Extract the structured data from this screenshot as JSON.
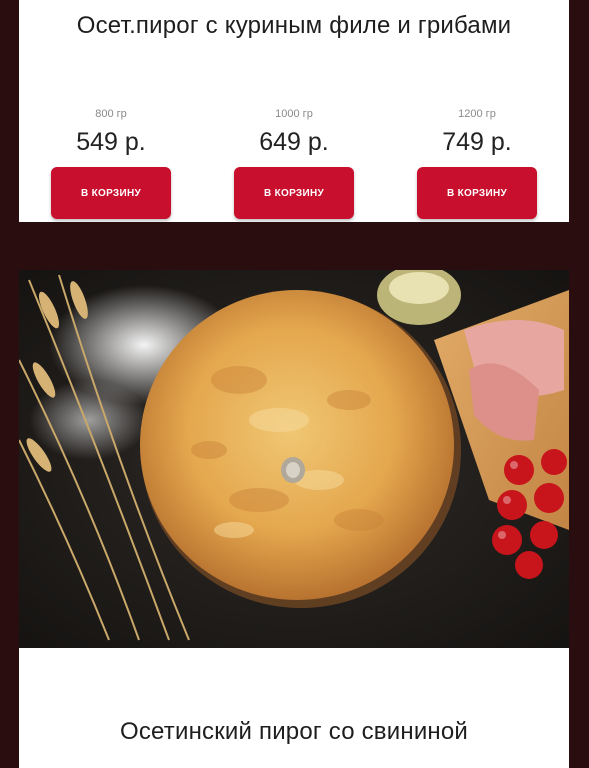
{
  "product1": {
    "title": "Осет.пирог с куриным филе и грибами",
    "variants": [
      {
        "weight": "800 гр",
        "price": "549 р.",
        "button": "В КОРЗИНУ"
      },
      {
        "weight": "1000 гр",
        "price": "649 р.",
        "button": "В КОРЗИНУ"
      },
      {
        "weight": "1200 гр",
        "price": "749 р.",
        "button": "В КОРЗИНУ"
      }
    ]
  },
  "product2": {
    "title": "Осетинский пирог со свининой"
  },
  "colors": {
    "accent": "#c8102e",
    "background": "#2a0d0f"
  }
}
